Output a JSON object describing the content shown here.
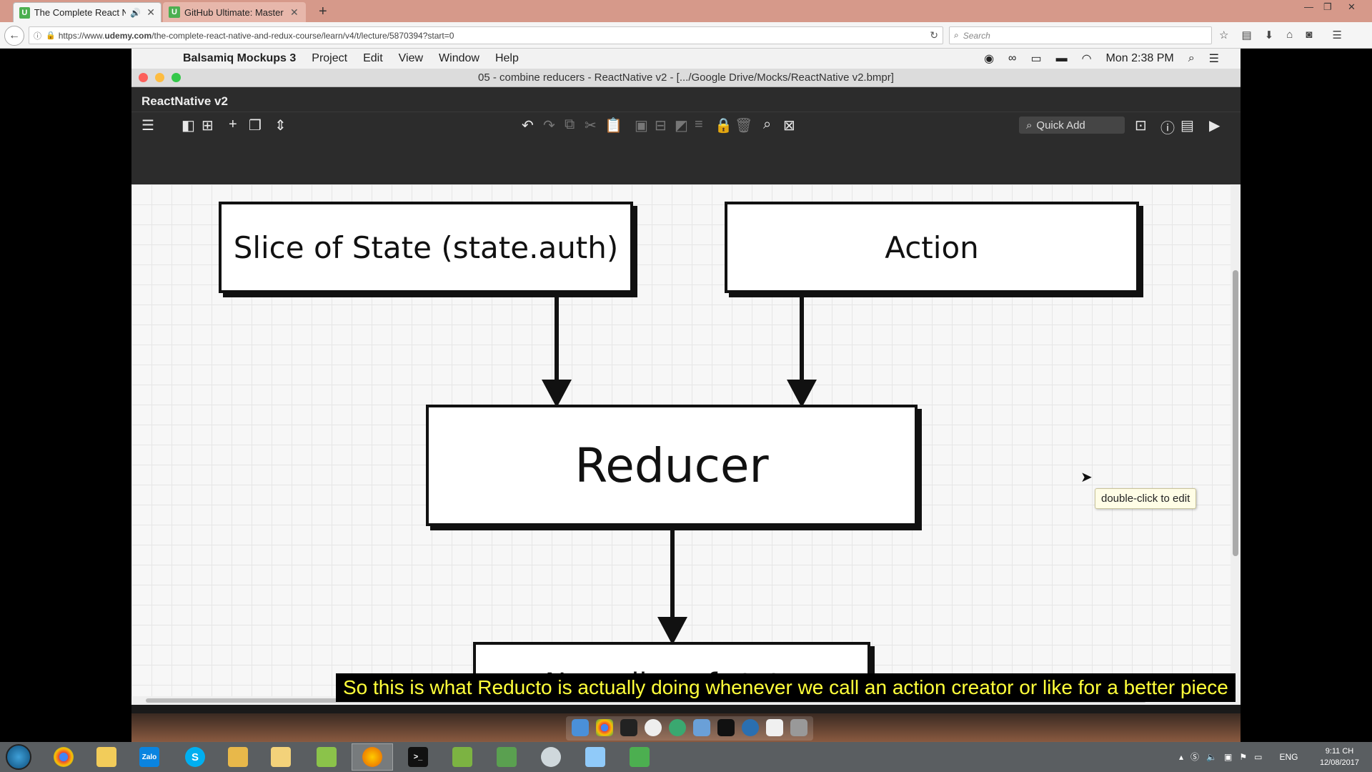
{
  "browser": {
    "tabs": [
      {
        "title": "The Complete React Nat",
        "favicon": "U",
        "audio": true
      },
      {
        "title": "GitHub Ultimate: Master Git",
        "favicon": "U"
      }
    ],
    "url_prefix": "https://www.",
    "url_domain": "udemy.com",
    "url_path": "/the-complete-react-native-and-redux-course/learn/v4/t/lecture/5870394?start=0",
    "search_placeholder": "Search"
  },
  "mac": {
    "menubar": {
      "app": "Balsamiq Mockups 3",
      "items": [
        "Project",
        "Edit",
        "View",
        "Window",
        "Help"
      ],
      "clock": "Mon 2:38 PM"
    },
    "window_title": "05 - combine reducers - ReactNative v2 - [.../Google Drive/Mocks/ReactNative v2.bmpr]",
    "project_name": "ReactNative v2",
    "quick_add": "Quick Add"
  },
  "diagram": {
    "boxes": {
      "slice": "Slice of State (state.auth)",
      "action": "Action",
      "reducer": "Reducer",
      "new_slice": "New slice of state"
    },
    "tooltip": "double-click to edit"
  },
  "subtitle": "So this is what Reducto is actually doing whenever we call an action creator or like for a better piece",
  "taskbar": {
    "lang": "ENG",
    "time": "9:11 CH",
    "date": "12/08/2017"
  },
  "colors": {
    "tabbar": "#d6998a",
    "subtitle_text": "#ffff3a",
    "canvas_bg": "#f7f7f7"
  }
}
